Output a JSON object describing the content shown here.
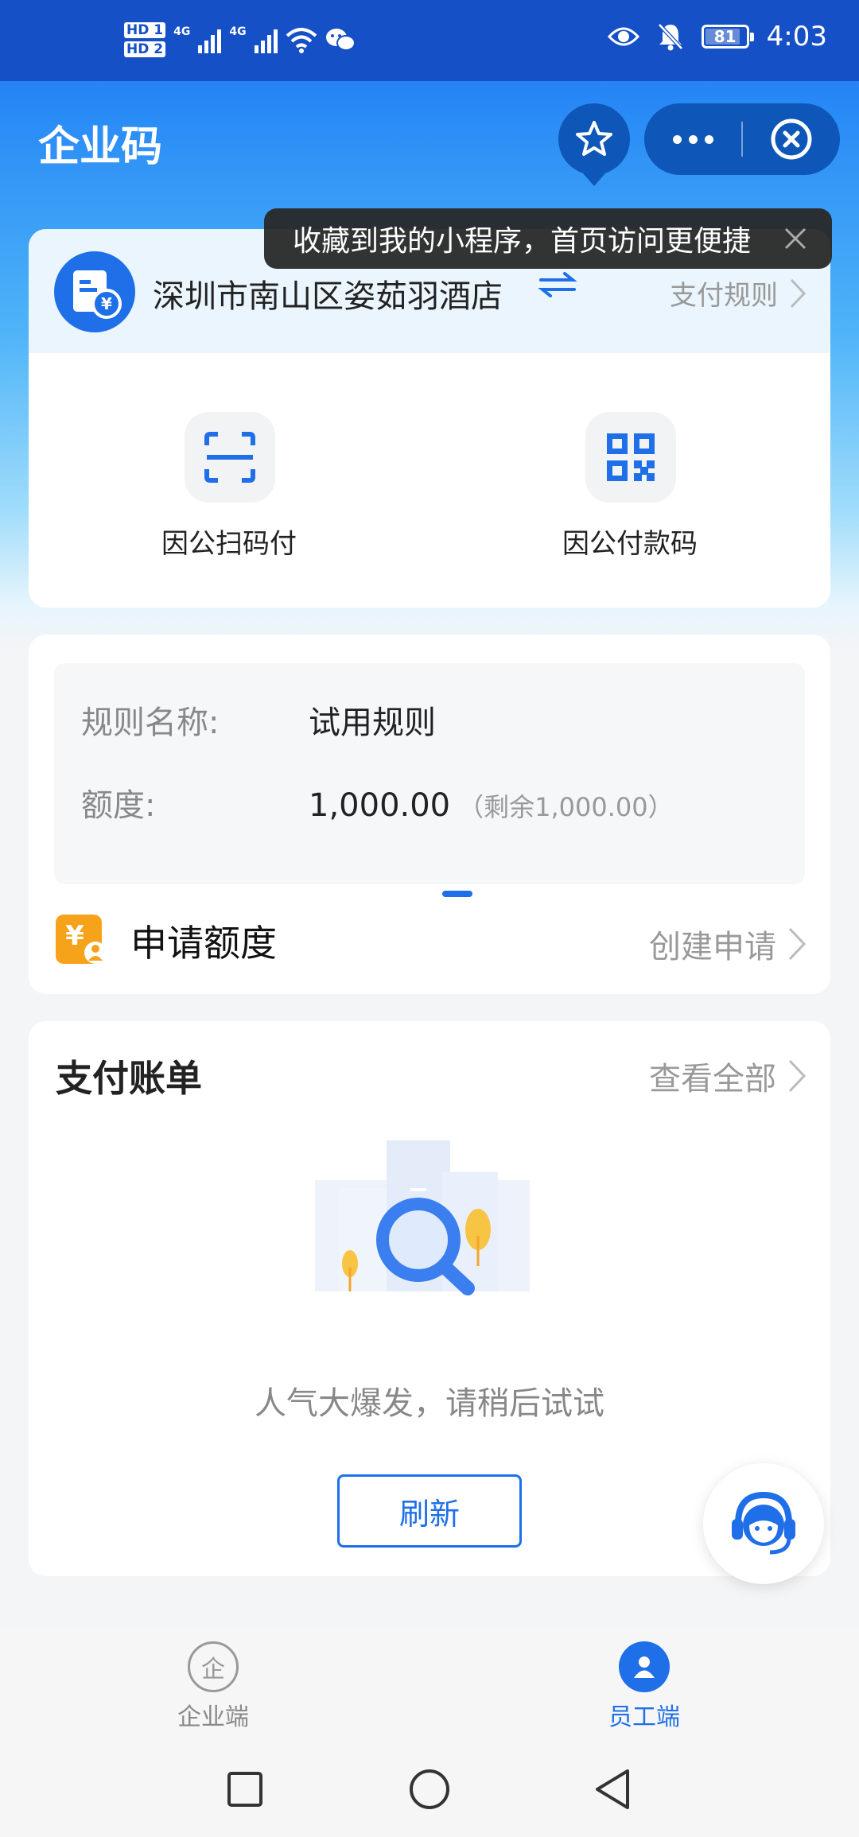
{
  "status_bar": {
    "hd1": "HD 1",
    "hd2": "HD 2",
    "net1": "4G",
    "net2": "4G",
    "battery": "81",
    "time": "4:03"
  },
  "header": {
    "title": "企业码"
  },
  "tooltip": {
    "text": "收藏到我的小程序，首页访问更便捷"
  },
  "company": {
    "name": "深圳市南山区姿茹羽酒店",
    "pay_rules_label": "支付规则"
  },
  "actions": [
    {
      "label": "因公扫码付",
      "icon": "scan-icon"
    },
    {
      "label": "因公付款码",
      "icon": "qr-code-icon"
    }
  ],
  "rule": {
    "name_label": "规则名称:",
    "name_value": "试用规则",
    "quota_label": "额度:",
    "quota_value": "1,000.00",
    "quota_remaining": "（剩余1,000.00）"
  },
  "apply": {
    "title": "申请额度",
    "link": "创建申请"
  },
  "bill": {
    "title": "支付账单",
    "view_all": "查看全部",
    "empty_text": "人气大爆发，请稍后试试",
    "refresh_label": "刷新"
  },
  "tabbar": {
    "tabs": [
      {
        "label": "企业端",
        "active": false,
        "icon_char": "企"
      },
      {
        "label": "员工端",
        "active": true
      }
    ]
  },
  "colors": {
    "accent": "#1e6fe8",
    "status_bar": "#1650c6",
    "apply_icon": "#f7a21b"
  }
}
